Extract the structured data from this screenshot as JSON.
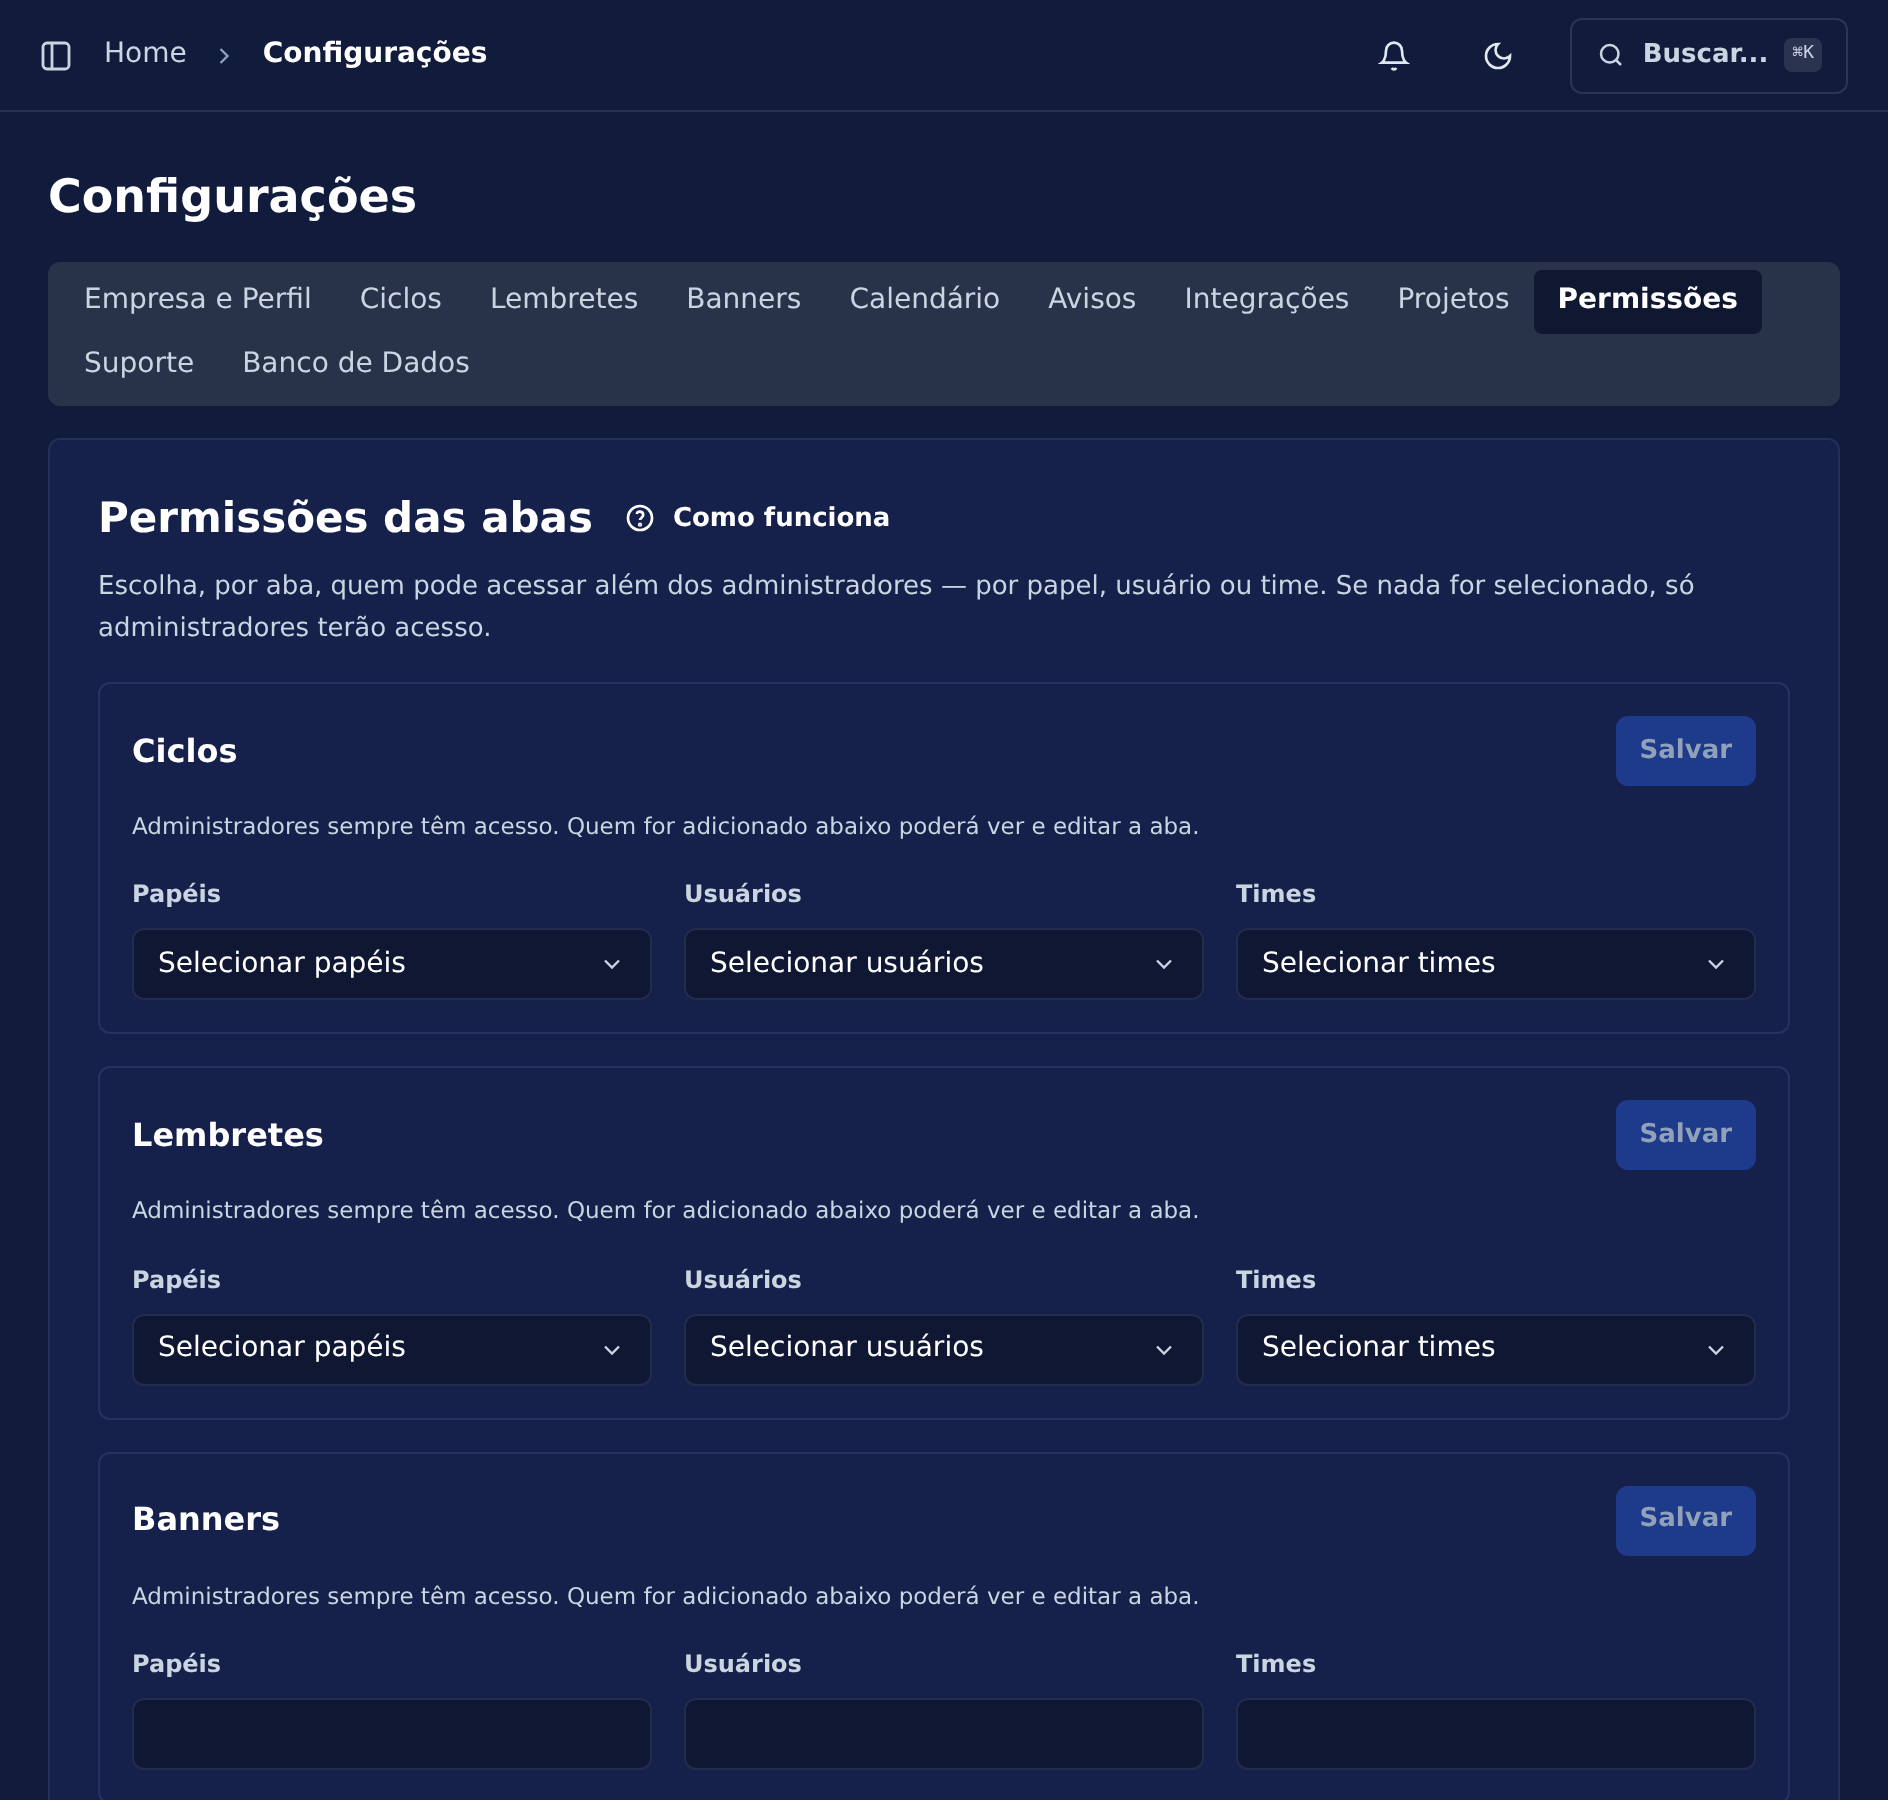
{
  "breadcrumb": {
    "items": [
      "Home",
      "Configurações"
    ]
  },
  "header": {
    "search": {
      "placeholder": "Buscar...",
      "shortcut": "⌘K"
    }
  },
  "page_title": "Configurações",
  "tabs": [
    {
      "label": "Empresa e Perfil",
      "selected": false
    },
    {
      "label": "Ciclos",
      "selected": false
    },
    {
      "label": "Lembretes",
      "selected": false
    },
    {
      "label": "Banners",
      "selected": false
    },
    {
      "label": "Calendário",
      "selected": false
    },
    {
      "label": "Avisos",
      "selected": false
    },
    {
      "label": "Integrações",
      "selected": false
    },
    {
      "label": "Projetos",
      "selected": false
    },
    {
      "label": "Permissões",
      "selected": true
    },
    {
      "label": "Suporte",
      "selected": false
    },
    {
      "label": "Banco de Dados",
      "selected": false
    }
  ],
  "section": {
    "title": "Permissões das abas",
    "help_link": "Como funciona",
    "description": "Escolha, por aba, quem pode acessar além dos administradores — por papel, usuário ou time. Se nada for selecionado, só administradores terão acesso.",
    "cards": [
      {
        "title": "Ciclos",
        "save_button": {
          "label": "Salvar",
          "disabled": true
        },
        "note": "Administradores sempre têm acesso. Quem for adicionado abaixo poderá ver e editar a aba.",
        "fields": [
          {
            "label": "Papéis",
            "placeholder": "Selecionar papéis"
          },
          {
            "label": "Usuários",
            "placeholder": "Selecionar usuários"
          },
          {
            "label": "Times",
            "placeholder": "Selecionar times"
          }
        ]
      },
      {
        "title": "Lembretes",
        "save_button": {
          "label": "Salvar",
          "disabled": true
        },
        "note": "Administradores sempre têm acesso. Quem for adicionado abaixo poderá ver e editar a aba.",
        "fields": [
          {
            "label": "Papéis",
            "placeholder": "Selecionar papéis"
          },
          {
            "label": "Usuários",
            "placeholder": "Selecionar usuários"
          },
          {
            "label": "Times",
            "placeholder": "Selecionar times"
          }
        ]
      },
      {
        "title": "Banners",
        "save_button": {
          "label": "Salvar",
          "disabled": true
        },
        "note": "Administradores sempre têm acesso. Quem for adicionado abaixo poderá ver e editar a aba.",
        "fields": [
          {
            "label": "Papéis"
          },
          {
            "label": "Usuários"
          },
          {
            "label": "Times"
          }
        ]
      }
    ]
  }
}
